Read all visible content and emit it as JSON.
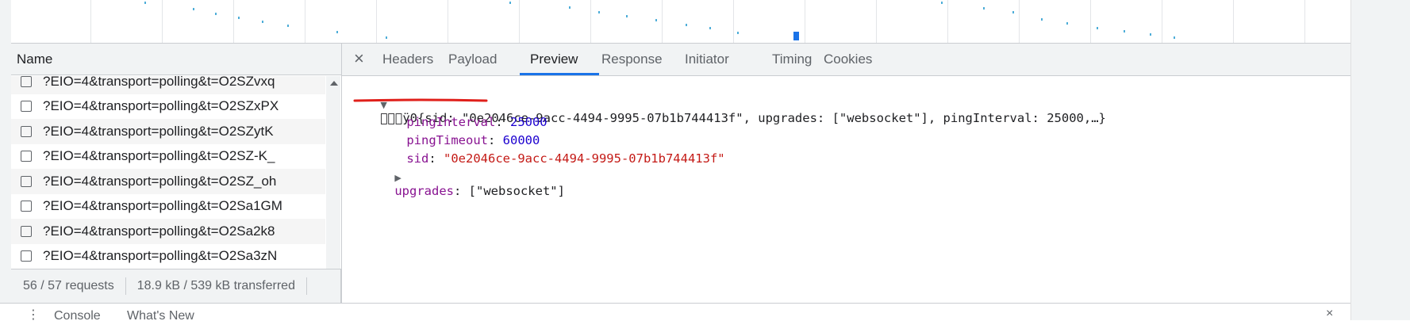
{
  "request_list": {
    "column_header": "Name",
    "rows": [
      "?EIO=4&transport=polling&t=O2SZvxq",
      "?EIO=4&transport=polling&t=O2SZxPX",
      "?EIO=4&transport=polling&t=O2SZytK",
      "?EIO=4&transport=polling&t=O2SZ-K_",
      "?EIO=4&transport=polling&t=O2SZ_oh",
      "?EIO=4&transport=polling&t=O2Sa1GM",
      "?EIO=4&transport=polling&t=O2Sa2k8",
      "?EIO=4&transport=polling&t=O2Sa3zN"
    ],
    "status": {
      "requests": "56 / 57 requests",
      "transferred": "18.9 kB / 539 kB transferred"
    }
  },
  "detail": {
    "tabs": [
      "Headers",
      "Payload",
      "Preview",
      "Response",
      "Initiator",
      "Timing",
      "Cookies"
    ],
    "active_tab": "Preview",
    "preview": {
      "summary_prefix": "\u0000\u0000\u0000ÿ0",
      "summary_body": "{sid: \"0e2046ce-9acc-4494-9995-07b1b744413f\", upgrades: [\"websocket\"], pingInterval: 25000,…}",
      "props": [
        {
          "key": "pingInterval",
          "value": "25000",
          "kind": "number"
        },
        {
          "key": "pingTimeout",
          "value": "60000",
          "kind": "number"
        },
        {
          "key": "sid",
          "value": "\"0e2046ce-9acc-4494-9995-07b1b744413f\"",
          "kind": "string"
        }
      ],
      "upgrades_key": "upgrades",
      "upgrades_value": "[\"websocket\"]"
    }
  },
  "drawer": {
    "tabs": [
      "Console",
      "What's New"
    ]
  },
  "colors": {
    "accent": "#1a73e8",
    "key": "#881391",
    "number": "#1c00cf",
    "string": "#c41a16",
    "annotation": "#e0201b"
  }
}
